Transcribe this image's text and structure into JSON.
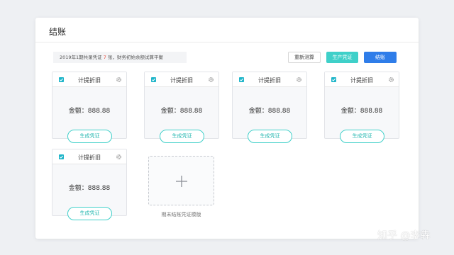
{
  "panel": {
    "title": "结账",
    "summary_prefix": "2019年1期共录凭证",
    "summary_count": "7",
    "summary_suffix": "张，财务初始余额试算平衡"
  },
  "toolbar": {
    "recalc_label": "重新测算",
    "generate_label": "生产凭证",
    "close_label": "结账"
  },
  "cards": [
    {
      "title": "计提折旧",
      "amount": "金额：888.88",
      "action": "生成凭证",
      "checked": true
    },
    {
      "title": "计提折旧",
      "amount": "金额：888.88",
      "action": "生成凭证",
      "checked": true
    },
    {
      "title": "计提折旧",
      "amount": "金额：888.88",
      "action": "生成凭证",
      "checked": true
    },
    {
      "title": "计提折旧",
      "amount": "金额：888.88",
      "action": "生成凭证",
      "checked": true
    },
    {
      "title": "计提折旧",
      "amount": "金额：888.88",
      "action": "生成凭证",
      "checked": true
    }
  ],
  "template": {
    "label": "期末结账凭证模版",
    "icon": "plus-icon"
  },
  "watermark": "知乎 @李犇",
  "colors": {
    "accent_teal": "#3fd0c9",
    "primary_blue": "#2f7de9",
    "highlight_red": "#e74c3c",
    "check_teal": "#1fb5c9"
  }
}
